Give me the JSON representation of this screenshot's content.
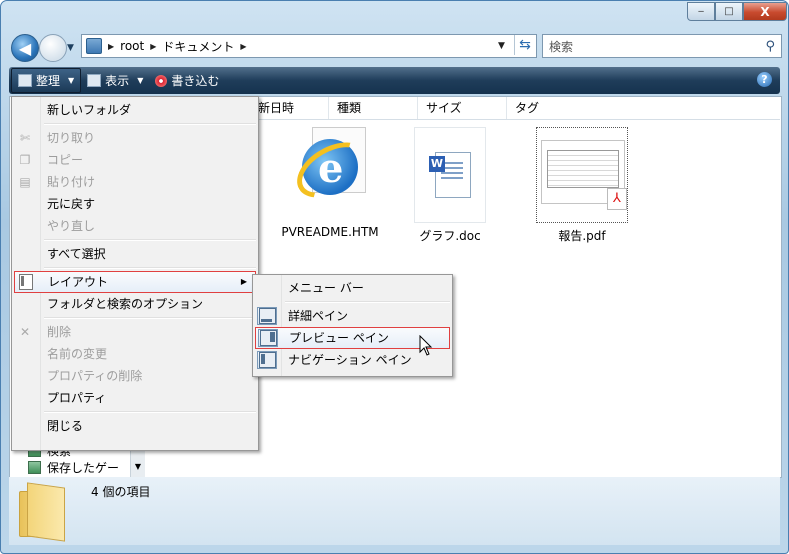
{
  "caption": {
    "minimize": "‒",
    "maximize": "□",
    "close": "X"
  },
  "address": {
    "crumbs": [
      "root",
      "ドキュメント"
    ]
  },
  "search": {
    "placeholder": "検索"
  },
  "toolbar": {
    "organize": "整理",
    "view": "表示",
    "burn": "書き込む",
    "help": "?"
  },
  "columns": [
    "新日時",
    "種類",
    "サイズ",
    "タグ"
  ],
  "files": [
    {
      "name": "PVREADME.HTM",
      "icon": "ie-icon"
    },
    {
      "name": "グラフ.doc",
      "icon": "word-icon"
    },
    {
      "name": "報告.pdf",
      "icon": "pdf-icon"
    }
  ],
  "organize_menu": {
    "new_folder": "新しいフォルダ",
    "cut": "切り取り",
    "copy": "コピー",
    "paste": "貼り付け",
    "undo": "元に戻す",
    "redo": "やり直し",
    "select_all": "すべて選択",
    "layout": "レイアウト",
    "folder_options": "フォルダと検索のオプション",
    "delete": "削除",
    "rename": "名前の変更",
    "remove_props": "プロパティの削除",
    "properties": "プロパティ",
    "close": "閉じる"
  },
  "layout_menu": {
    "menu_bar": "メニュー バー",
    "details_pane": "詳細ペイン",
    "preview_pane": "プレビュー ペイン",
    "nav_pane": "ナビゲーション ペイン"
  },
  "nav": {
    "items": [
      "検索",
      "保存したゲー"
    ]
  },
  "details": {
    "count": "4 個の項目"
  },
  "colors": {
    "toolbar": "#1f3d5a",
    "highlight_border": "#e04040"
  }
}
